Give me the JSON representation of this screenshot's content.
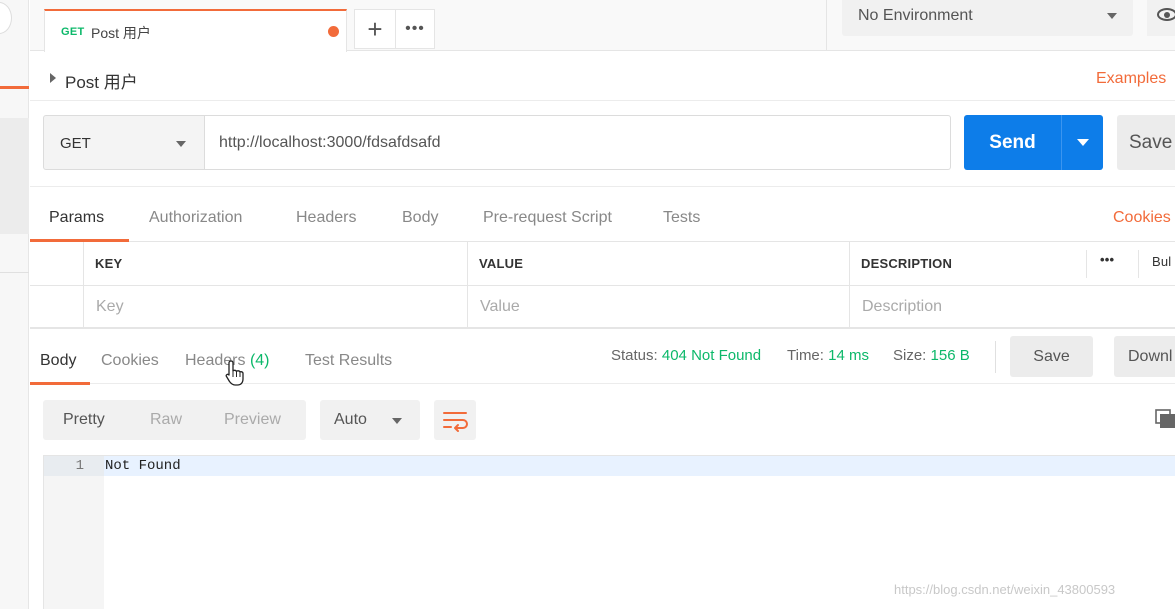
{
  "tabbar": {
    "request_tab": {
      "method": "GET",
      "title": "Post 用户"
    },
    "more_label": "•••",
    "environment": "No Environment"
  },
  "request": {
    "name": "Post 用户",
    "examples_label": "Examples",
    "method": "GET",
    "url": "http://localhost:3000/fdsafdsafd",
    "send_label": "Send",
    "save_label": "Save"
  },
  "request_tabs": {
    "items": [
      "Params",
      "Authorization",
      "Headers",
      "Body",
      "Pre-request Script",
      "Tests"
    ],
    "active": "Params",
    "cookies_label": "Cookies"
  },
  "params_table": {
    "headers": [
      "KEY",
      "VALUE",
      "DESCRIPTION"
    ],
    "placeholders": [
      "Key",
      "Value",
      "Description"
    ],
    "more_label": "•••",
    "bulk_label": "Bul"
  },
  "response": {
    "tabs": {
      "body": "Body",
      "cookies": "Cookies",
      "headers": "Headers",
      "headers_count": "(4)",
      "tests": "Test Results"
    },
    "status_label": "Status:",
    "status_value": "404 Not Found",
    "time_label": "Time:",
    "time_value": "14 ms",
    "size_label": "Size:",
    "size_value": "156 B",
    "save_label": "Save",
    "download_label": "Downl",
    "view_tabs": [
      "Pretty",
      "Raw",
      "Preview"
    ],
    "active_view": "Pretty",
    "format": "Auto",
    "body_lines": [
      {
        "number": "1",
        "text": "Not Found"
      }
    ]
  },
  "watermark": "https://blog.csdn.net/weixin_43800593",
  "colors": {
    "accent": "#f26b3a",
    "primary_button": "#0d7de9",
    "success": "#0cb86a"
  }
}
